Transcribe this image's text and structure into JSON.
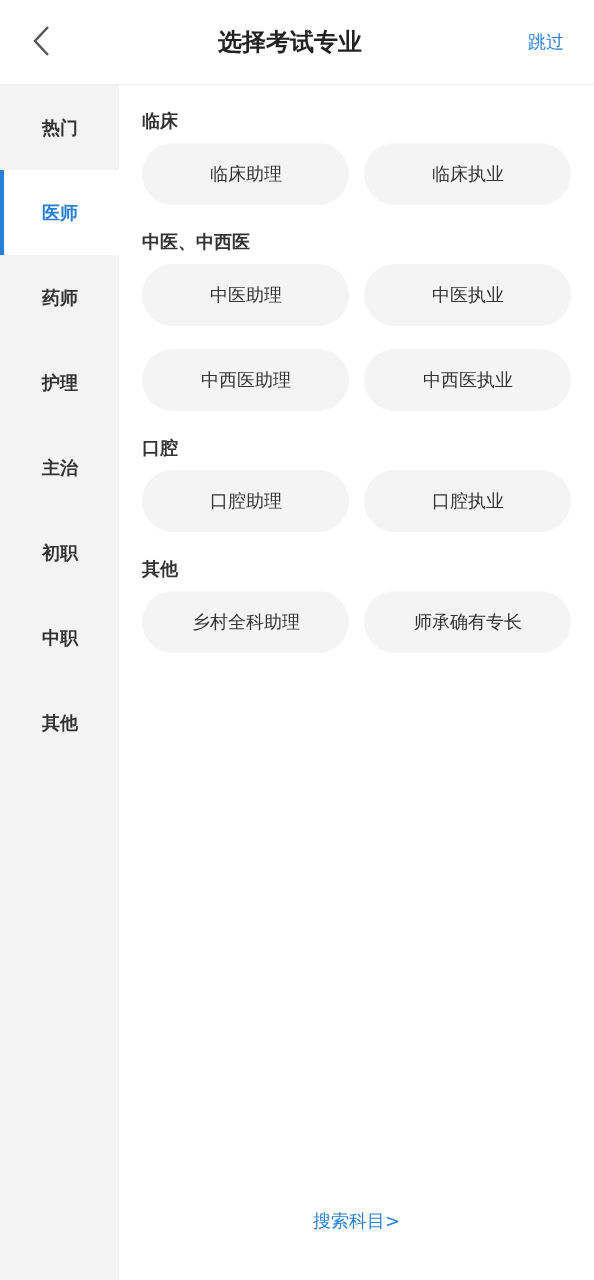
{
  "header": {
    "title": "选择考试专业",
    "skip": "跳过"
  },
  "sidebar": {
    "items": [
      {
        "label": "热门",
        "selected": false
      },
      {
        "label": "医师",
        "selected": true
      },
      {
        "label": "药师",
        "selected": false
      },
      {
        "label": "护理",
        "selected": false
      },
      {
        "label": "主治",
        "selected": false
      },
      {
        "label": "初职",
        "selected": false
      },
      {
        "label": "中职",
        "selected": false
      },
      {
        "label": "其他",
        "selected": false
      }
    ]
  },
  "sections": [
    {
      "title": "临床",
      "options": [
        "临床助理",
        "临床执业"
      ]
    },
    {
      "title": "中医、中西医",
      "options": [
        "中医助理",
        "中医执业",
        "中西医助理",
        "中西医执业"
      ]
    },
    {
      "title": "口腔",
      "options": [
        "口腔助理",
        "口腔执业"
      ]
    },
    {
      "title": "其他",
      "options": [
        "乡村全科助理",
        "师承确有专长"
      ]
    }
  ],
  "footer_link": "搜索科目>"
}
